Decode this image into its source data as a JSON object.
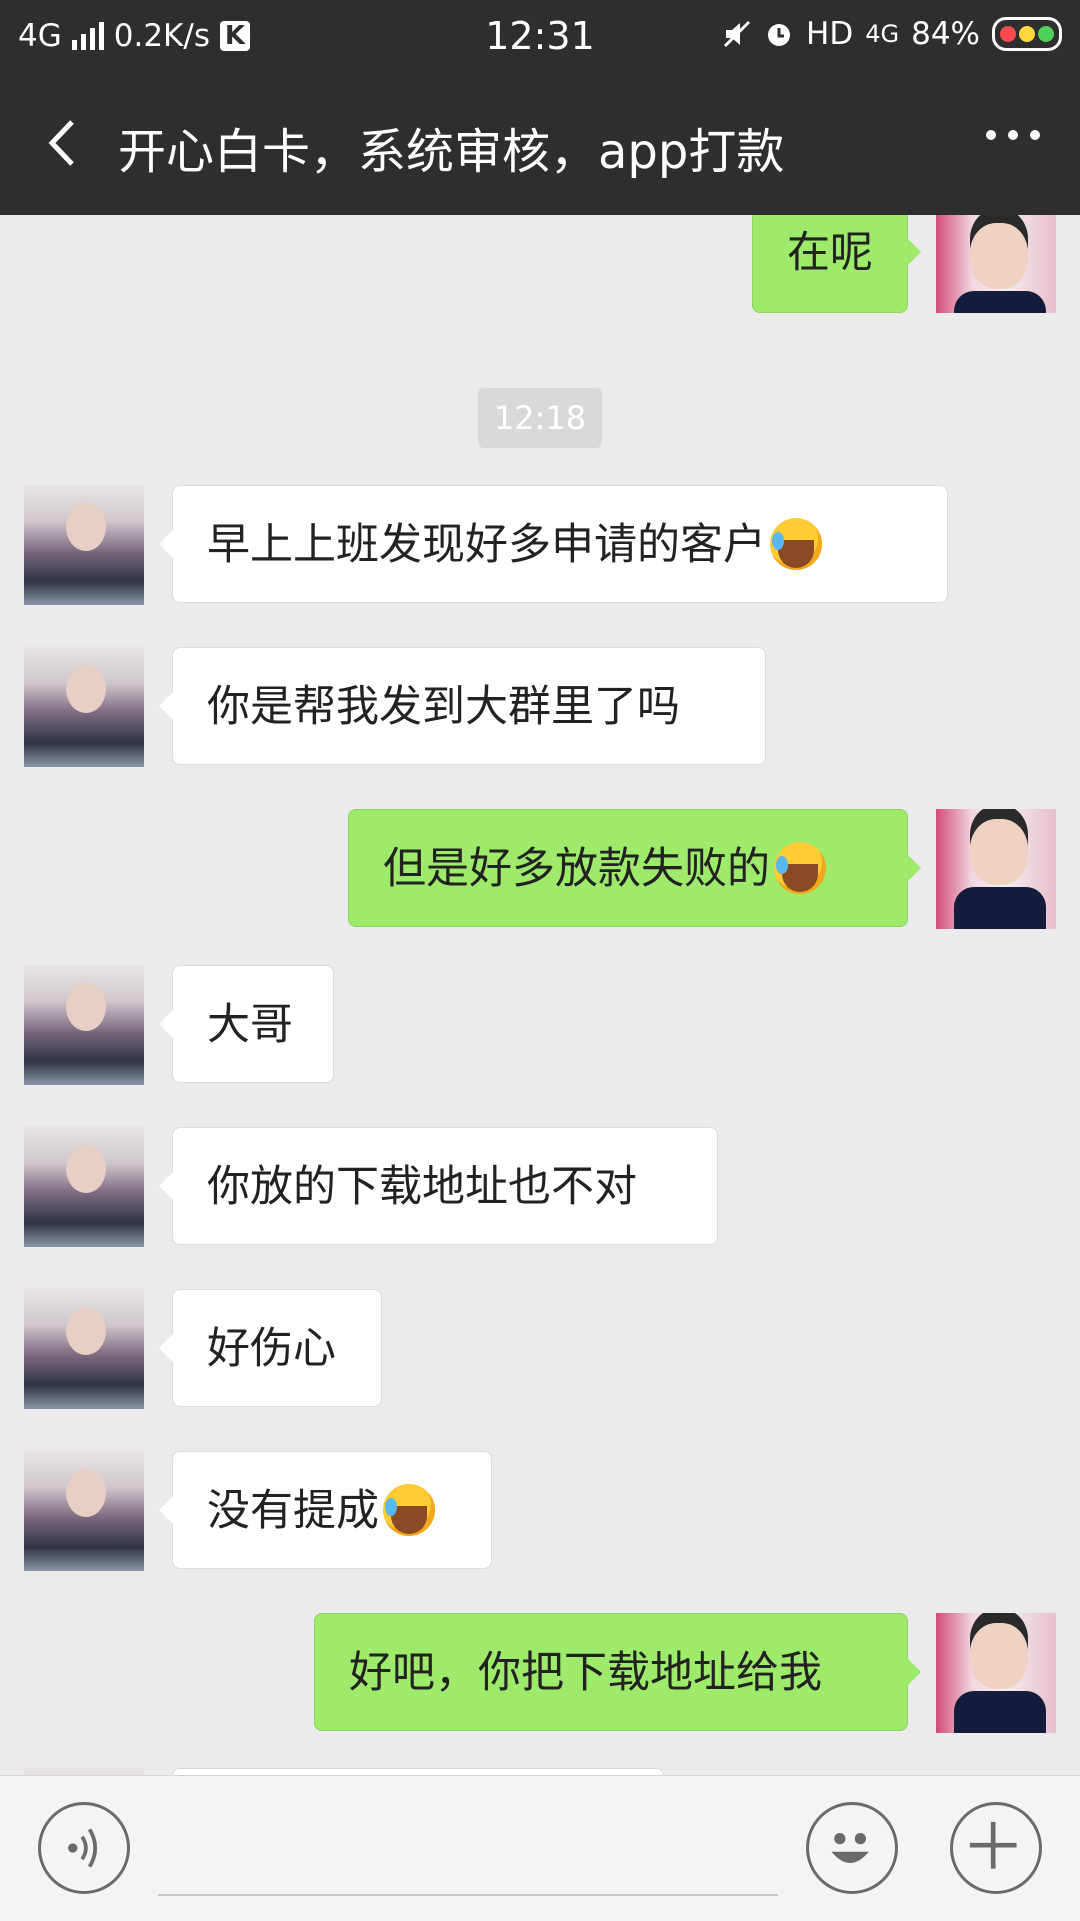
{
  "status_bar": {
    "network": "4G",
    "speed": "0.2K/s",
    "k_label": "K",
    "time": "12:31",
    "hd": "HD",
    "network2": "4G",
    "battery": "84%"
  },
  "header": {
    "title": "开心白卡，系统审核，app打款"
  },
  "chat": {
    "timestamp": "12:18",
    "messages": [
      {
        "side": "out",
        "text": "在呢"
      },
      {
        "side": "in",
        "text": "早上上班发现好多申请的客户",
        "emoji": "face-with-tears-emoji"
      },
      {
        "side": "in",
        "text": "你是帮我发到大群里了吗"
      },
      {
        "side": "out",
        "text": "但是好多放款失败的",
        "emoji": "face-with-tears-emoji"
      },
      {
        "side": "in",
        "text": "大哥"
      },
      {
        "side": "in",
        "text": "你放的下载地址也不对"
      },
      {
        "side": "in",
        "text": "好伤心"
      },
      {
        "side": "in",
        "text": "没有提成",
        "emoji": "face-with-tears-emoji"
      },
      {
        "side": "out",
        "text": "好吧，你把下载地址给我"
      }
    ]
  },
  "colors": {
    "bar": "#2e2e2e",
    "chat_bg": "#ebebeb",
    "bubble_out": "#9eea6a",
    "bubble_in": "#ffffff"
  }
}
